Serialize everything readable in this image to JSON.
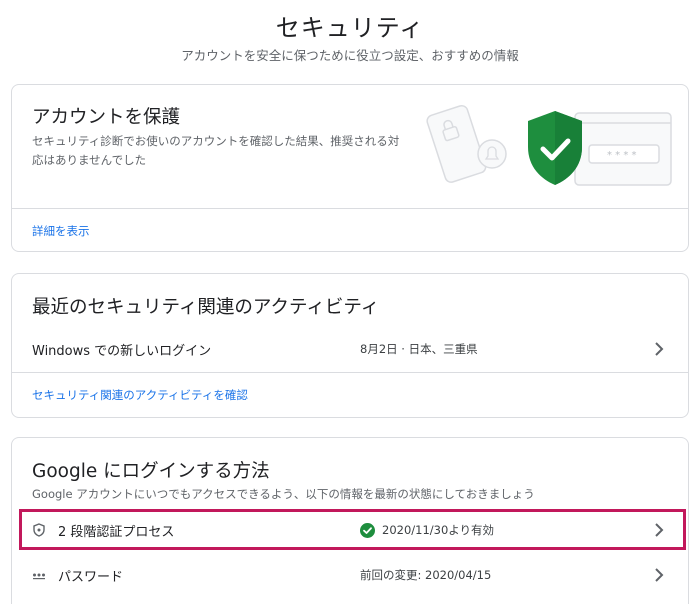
{
  "header": {
    "title": "セキュリティ",
    "subtitle": "アカウントを安全に保つために役立つ設定、おすすめの情報"
  },
  "protect": {
    "heading": "アカウントを保護",
    "description_line1": "セキュリティ診断でお使いのアカウントを確認した結果、推奨される対",
    "description_line2": "応はありませんでした",
    "link": "詳細を表示",
    "password_mask": "* * * *"
  },
  "activity": {
    "heading": "最近のセキュリティ関連のアクティビティ",
    "row_label": "Windows での新しいログイン",
    "row_meta": "8月2日 · 日本、三重県",
    "link": "セキュリティ関連のアクティビティを確認"
  },
  "signin": {
    "heading": "Google にログインする方法",
    "description": "Google アカウントにいつでもアクセスできるよう、以下の情報を最新の状態にしておきましょう",
    "rows": [
      {
        "label": "2 段階認証プロセス",
        "status": "2020/11/30より有効",
        "icon": "shield-icon"
      },
      {
        "label": "パスワード",
        "status": "前回の変更: 2020/04/15",
        "icon": "password-dots-icon"
      }
    ]
  },
  "colors": {
    "accent_link": "#1a73e8",
    "shield_green": "#1e8e3e",
    "highlight": "#c2185b",
    "border": "#dadce0"
  }
}
